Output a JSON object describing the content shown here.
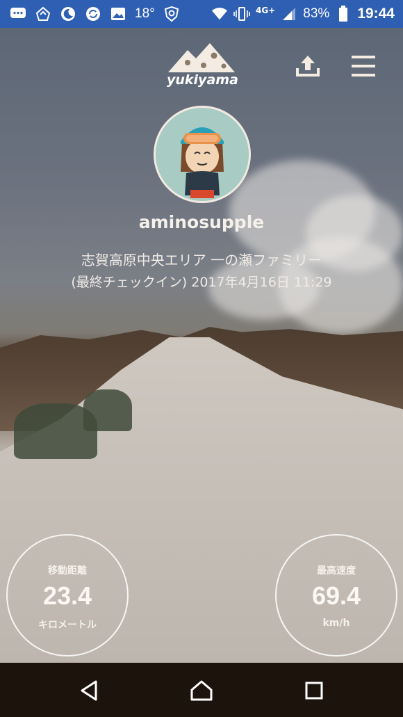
{
  "status_bar": {
    "temperature": "18°",
    "network": "4G+",
    "battery_percent": "83%",
    "time": "19:44",
    "bar_color": "#2f5fb3"
  },
  "header": {
    "logo_text": "yukiyama",
    "share_icon": "share-upload-icon",
    "menu_icon": "hamburger-menu-icon"
  },
  "profile": {
    "username": "aminosupple",
    "area": "志賀高原中央エリア 一の瀬ファミリー",
    "checkin": "(最終チェックイン) 2017年4月16日 11:29"
  },
  "stats": {
    "distance": {
      "label": "移動距離",
      "value": "23.4",
      "unit": "キロメートル"
    },
    "speed": {
      "label": "最高速度",
      "value": "69.4",
      "unit": "km/h"
    }
  },
  "nav": {
    "back_icon": "back-triangle-icon",
    "home_icon": "home-icon",
    "recents_icon": "recents-square-icon"
  }
}
